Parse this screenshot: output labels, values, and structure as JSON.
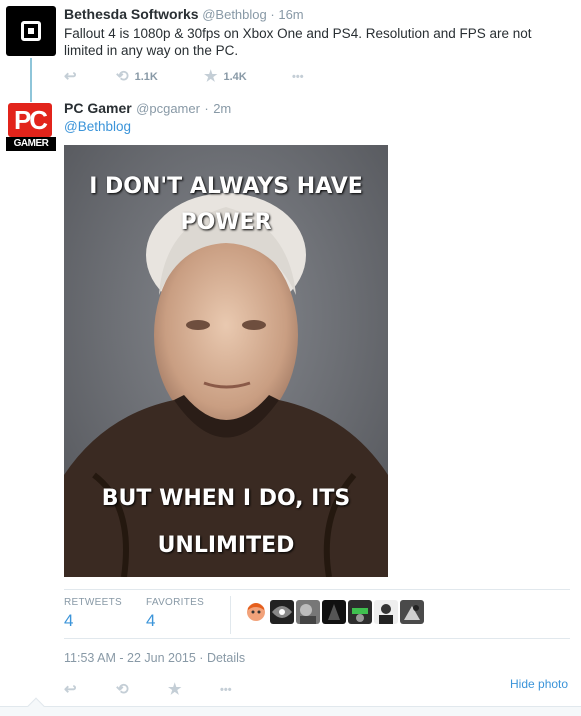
{
  "tweet1": {
    "name": "Bethesda Softworks",
    "handle": "@Bethblog",
    "separator": "·",
    "time": "16m",
    "text": "Fallout 4 is 1080p & 30fps on Xbox One and PS4. Resolution and FPS are not limited in any way on the PC.",
    "retweet_count": "1.1K",
    "favorite_count": "1.4K"
  },
  "tweet2": {
    "name": "PC Gamer",
    "handle": "@pcgamer",
    "separator": "·",
    "time": "2m",
    "reply_to": "@Bethblog",
    "avatar_top": "PC",
    "avatar_bottom": "GAMER",
    "meme_top_line1": "I DON'T ALWAYS HAVE",
    "meme_top_line2": "POWER",
    "meme_bottom_line1": "BUT WHEN I DO, ITS",
    "meme_bottom_line2": "UNLIMITED",
    "stats": {
      "retweets_label": "RETWEETS",
      "retweets_value": "4",
      "favorites_label": "FAVORITES",
      "favorites_value": "4"
    },
    "timestamp": "11:53 AM - 22 Jun 2015",
    "timestamp_sep": "·",
    "details_label": "Details",
    "hide_photo_label": "Hide photo"
  },
  "icons": {
    "reply": "↩",
    "retweet": "⟲",
    "favorite": "★",
    "more": "•••"
  },
  "colors": {
    "link": "#3b94d9",
    "muted": "#8899a6",
    "thread_line": "#8ec5d9",
    "pc_red": "#e2241b"
  }
}
